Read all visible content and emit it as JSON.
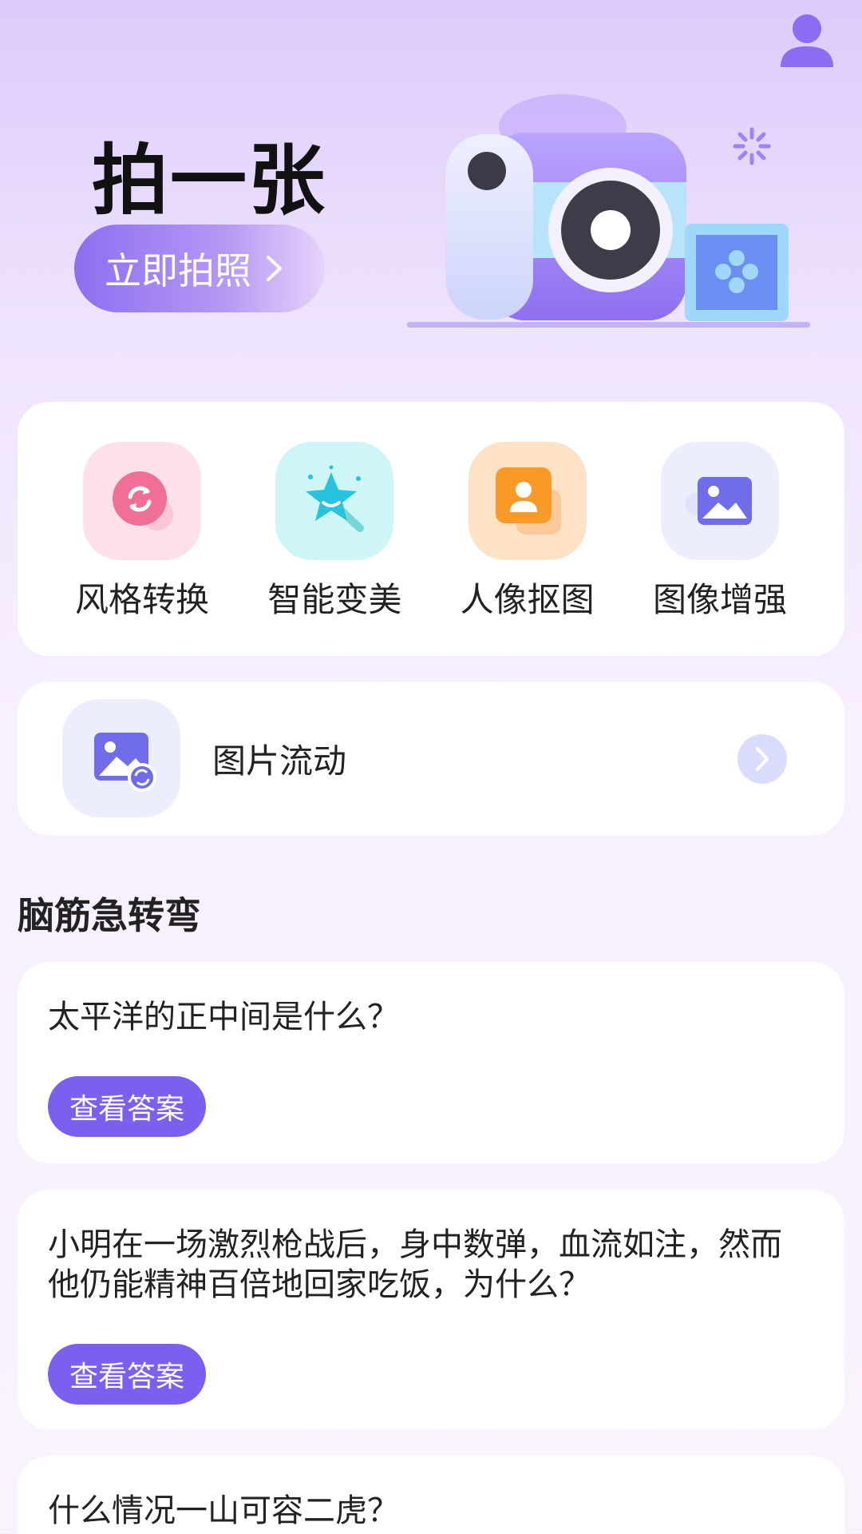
{
  "hero": {
    "title": "拍一张",
    "button_label": "立即拍照"
  },
  "tools": [
    {
      "label": "风格转换",
      "icon": "style-transfer-icon"
    },
    {
      "label": "智能变美",
      "icon": "magic-star-icon"
    },
    {
      "label": "人像抠图",
      "icon": "portrait-cutout-icon"
    },
    {
      "label": "图像增强",
      "icon": "image-enhance-icon"
    }
  ],
  "flow": {
    "label": "图片流动",
    "icon": "image-flow-icon"
  },
  "riddles": {
    "section_title": "脑筋急转弯",
    "answer_label": "查看答案",
    "items": [
      {
        "question": "太平洋的正中间是什么？"
      },
      {
        "question": "小明在一场激烈枪战后，身中数弹，血流如注，然而他仍能精神百倍地回家吃饭，为什么？"
      },
      {
        "question": "什么情况一山可容二虎？"
      }
    ]
  },
  "colors": {
    "accent": "#7d5ff0",
    "background_top": "#dccbfb",
    "background_bottom": "#faf2fd"
  }
}
